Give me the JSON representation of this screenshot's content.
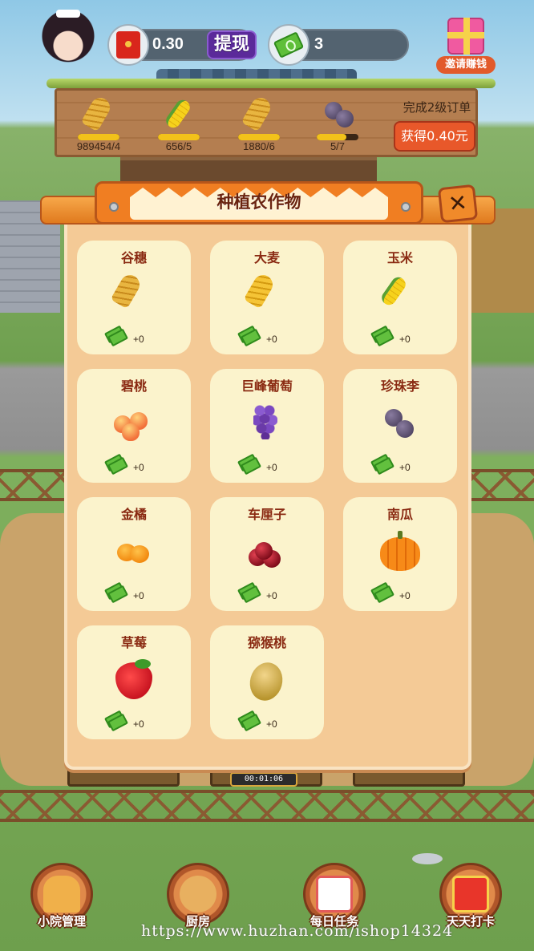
{
  "hud": {
    "cash_value": "0.30",
    "withdraw_label": "提现",
    "gem_value": "3",
    "invite_label": "邀请赚钱"
  },
  "order_board": {
    "title": "完成2级订单",
    "reward_button": "获得0.40元",
    "items": [
      {
        "icon": "wheat-icon",
        "count": "989454/4",
        "progress": 1.0
      },
      {
        "icon": "corn-icon",
        "count": "656/5",
        "progress": 1.0
      },
      {
        "icon": "wheat-icon",
        "count": "1880/6",
        "progress": 1.0
      },
      {
        "icon": "plum-icon",
        "count": "5/7",
        "progress": 0.71
      }
    ]
  },
  "modal": {
    "title": "种植农作物",
    "crops": [
      {
        "name": "谷穗",
        "icon": "millet-icon",
        "reward": "+0"
      },
      {
        "name": "大麦",
        "icon": "barley-icon",
        "reward": "+0"
      },
      {
        "name": "玉米",
        "icon": "corn-icon",
        "reward": "+0"
      },
      {
        "name": "碧桃",
        "icon": "peach-icon",
        "reward": "+0"
      },
      {
        "name": "巨峰葡萄",
        "icon": "grape-icon",
        "reward": "+0"
      },
      {
        "name": "珍珠李",
        "icon": "plum-icon",
        "reward": "+0"
      },
      {
        "name": "金橘",
        "icon": "kumquat-icon",
        "reward": "+0"
      },
      {
        "name": "车厘子",
        "icon": "cherry-icon",
        "reward": "+0"
      },
      {
        "name": "南瓜",
        "icon": "pumpkin-icon",
        "reward": "+0"
      },
      {
        "name": "草莓",
        "icon": "strawberry-icon",
        "reward": "+0"
      },
      {
        "name": "猕猴桃",
        "icon": "kiwi-icon",
        "reward": "+0"
      }
    ]
  },
  "field": {
    "timer": "00:01:06"
  },
  "bottom_nav": [
    {
      "label": "小院管理",
      "icon": "house-icon"
    },
    {
      "label": "厨房",
      "icon": "kitchen-icon"
    },
    {
      "label": "每日任务",
      "icon": "calendar-icon"
    },
    {
      "label": "天天打卡",
      "icon": "gift-icon"
    }
  ],
  "watermark": "https://www.huzhan.com/ishop14324"
}
